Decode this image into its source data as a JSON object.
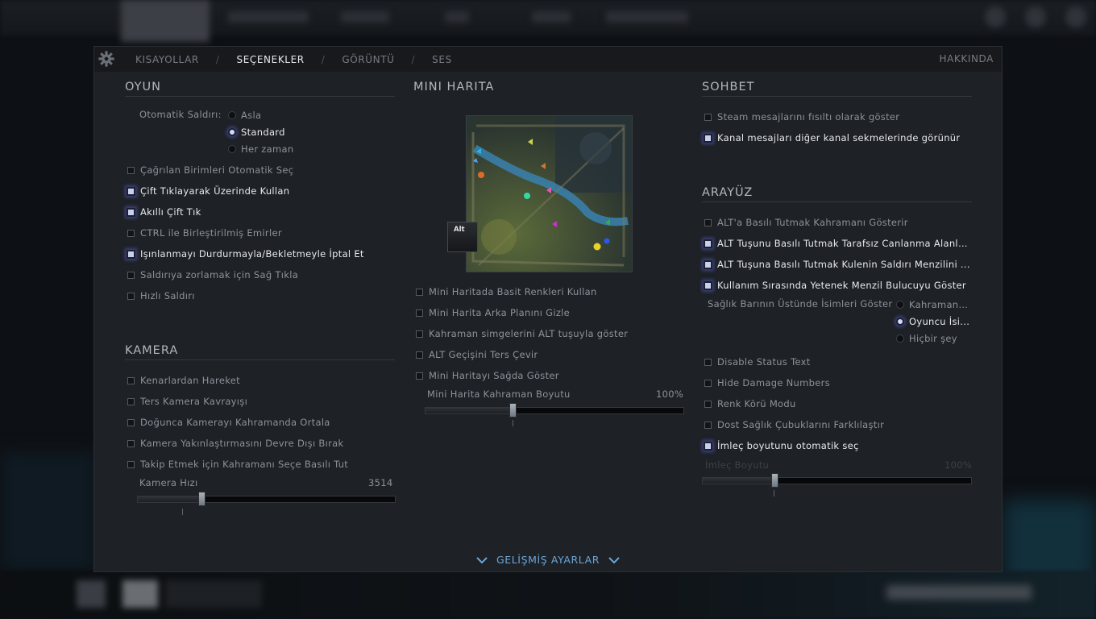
{
  "tabs": [
    "KISAYOLLAR",
    "SEÇENEKLER",
    "GÖRÜNTÜ",
    "SES"
  ],
  "about": "HAKKINDA",
  "oyun": {
    "title": "OYUN",
    "auto_attack_label": "Otomatik Saldırı:",
    "auto_attack_options": [
      "Asla",
      "Standard",
      "Her zaman"
    ],
    "auto_attack_selected": 1,
    "options": [
      {
        "label": "Çağrılan Birimleri Otomatik Seç",
        "checked": false
      },
      {
        "label": "Çift Tıklayarak Üzerinde Kullan",
        "checked": true
      },
      {
        "label": "Akıllı Çift Tık",
        "checked": true
      },
      {
        "label": "CTRL ile Birleştirilmiş Emirler",
        "checked": false
      },
      {
        "label": "Işınlanmayı Durdurmayla/Bekletmeyle İptal Et",
        "checked": true
      },
      {
        "label": "Saldırıya zorlamak için Sağ Tıkla",
        "checked": false
      },
      {
        "label": "Hızlı Saldırı",
        "checked": false
      }
    ]
  },
  "kamera": {
    "title": "KAMERA",
    "options": [
      {
        "label": "Kenarlardan Hareket",
        "checked": false
      },
      {
        "label": "Ters Kamera Kavrayışı",
        "checked": false
      },
      {
        "label": "Doğunca Kamerayı Kahramanda Ortala",
        "checked": false
      },
      {
        "label": "Kamera Yakınlaştırmasını Devre Dışı Bırak",
        "checked": false
      },
      {
        "label": "Takip Etmek için Kahramanı Seçe Basılı Tut",
        "checked": false
      }
    ],
    "speed_label": "Kamera Hızı",
    "speed_value": "3514",
    "speed_fraction": 0.25
  },
  "minimap": {
    "title": "MINI HARITA",
    "alt_key": "Alt",
    "options": [
      {
        "label": "Mini Haritada Basit Renkleri Kullan",
        "checked": false
      },
      {
        "label": "Mini Harita Arka Planını Gizle",
        "checked": false
      },
      {
        "label": "Kahraman simgelerini ALT tuşuyla göster",
        "checked": false
      },
      {
        "label": "ALT Geçişini Ters Çevir",
        "checked": false
      },
      {
        "label": "Mini Haritayı Sağda Göster",
        "checked": false
      }
    ],
    "hero_size_label": "Mini Harita Kahraman Boyutu",
    "hero_size_value": "100%",
    "hero_size_fraction": 0.34
  },
  "sohbet": {
    "title": "SOHBET",
    "options": [
      {
        "label": "Steam mesajlarını fısıltı olarak göster",
        "checked": false
      },
      {
        "label": "Kanal mesajları diğer kanal sekmelerinde görünür",
        "checked": true
      }
    ]
  },
  "arayuz": {
    "title": "ARAYÜZ",
    "options": [
      {
        "label": "ALT'a Basılı Tutmak Kahramanı Gösterir",
        "checked": false
      },
      {
        "label": "ALT Tuşunu Basılı Tutmak Tarafsız Canlanma Alanlar...",
        "checked": true
      },
      {
        "label": "ALT Tuşuna Basılı Tutmak Kulenin Saldırı Menzilini ...",
        "checked": true
      },
      {
        "label": "Kullanım Sırasında Yetenek Menzil Bulucuyu Göster",
        "checked": true
      }
    ],
    "names_label": "Sağlık Barının Üstünde İsimleri Göster",
    "names_options": [
      "Kahraman ...",
      "Oyuncu İsi...",
      "Hiçbir şey"
    ],
    "names_selected": 1,
    "options2": [
      {
        "label": "Disable Status Text",
        "checked": false
      },
      {
        "label": "Hide Damage Numbers",
        "checked": false
      },
      {
        "label": "Renk Körü Modu",
        "checked": false
      },
      {
        "label": "Dost Sağlık Çubuklarını Farklılaştır",
        "checked": false
      },
      {
        "label": "İmleç boyutunu otomatik seç",
        "checked": true
      }
    ],
    "cursor_size_label": "İmleç Boyutu",
    "cursor_size_value": "100%",
    "cursor_size_fraction": 0.27
  },
  "advanced": "GELİŞMİŞ AYARLAR",
  "colors": {
    "accent_blue": "#6ba6d8",
    "checked_glow": "#5860c4",
    "panel_bg": "#1e2126"
  }
}
